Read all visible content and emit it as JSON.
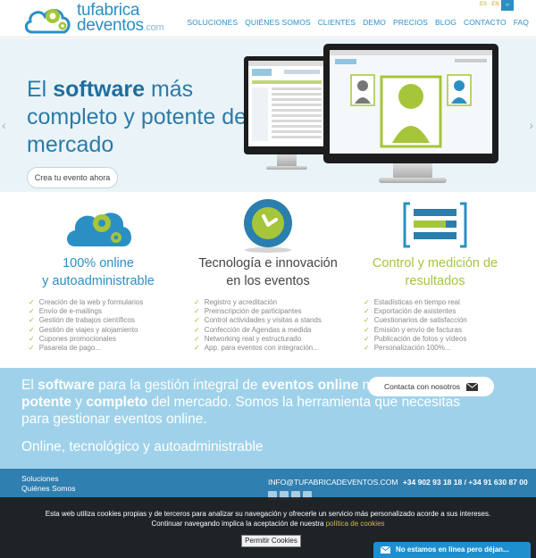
{
  "header": {
    "logo_line1": "tufabrica",
    "logo_line2": "deventos",
    "logo_domain": ".com",
    "lang": "ES · EN",
    "lang_badge": "‹›",
    "nav": [
      "SOLUCIONES",
      "QUIÉNES SOMOS",
      "CLIENTES",
      "DEMO",
      "PRECIOS",
      "BLOG",
      "CONTACTO",
      "FAQ"
    ]
  },
  "hero": {
    "title_pre": "El ",
    "title_bold": "software",
    "title_post": " más completo y potente del mercado",
    "button": "Crea tu evento ahora",
    "arrow_left": "‹",
    "arrow_right": "›"
  },
  "features": [
    {
      "title_line1": "100% online",
      "title_line2": "y autoadministrable",
      "color": "#2b8fc4",
      "items": [
        "Creación de la web y formularios",
        "Envío de e-mailings",
        "Gestión de trabajos científicos",
        "Gestión de viajes y alojamiento",
        "Cupones promocionales",
        "Pasarela de pago..."
      ]
    },
    {
      "title_line1": "Tecnología e innovación",
      "title_line2": "en los eventos",
      "color": "#444444",
      "items": [
        "Registro y acreditación",
        "Preinscripción de participantes",
        "Control actividades y visitas a stands",
        "Confección de Agendas a medida",
        "Networking real y estructurado",
        "App. para eventos con integración..."
      ]
    },
    {
      "title_line1": "Control y medición de",
      "title_line2": "resultados",
      "color": "#a6c53a",
      "items": [
        "Estadísticas en tiempo real",
        "Exportación de asistentes",
        "Cuestionarios de satisfacción",
        "Emisión y envío de facturas",
        "Publicación de fotos y vídeos",
        "Personalización 100%..."
      ]
    }
  ],
  "band": {
    "p1": "El ",
    "b1": "software",
    "p2": " para la gestión integral de ",
    "b2": "eventos online",
    "p3": " más ",
    "b3": "potente",
    "p4": " y ",
    "b4": "completo",
    "p5": " del mercado. Somos la herramienta que necesitas para gestionar eventos online.",
    "subtitle": "Online, tecnológico y autoadministrable",
    "contact_button": "Contacta con nosotros"
  },
  "footer": {
    "nav": [
      "Soluciones",
      "Quiénes Somos"
    ],
    "email": "INFO@TUFABRICADEVENTOS.COM",
    "phones": "+34 902 93 18 18 / +34 91 630 87 00"
  },
  "cookie": {
    "text": "Esta web utiliza cookies propias y de terceros para analizar su navegación y ofrecerle un servicio más personalizado acorde a sus intereses. Continuar navegando implica la aceptación de nuestra ",
    "link": "política de cookies",
    "button": "Permitir Cookies"
  },
  "chat": {
    "label": "No estamos en línea pero déjan..."
  }
}
